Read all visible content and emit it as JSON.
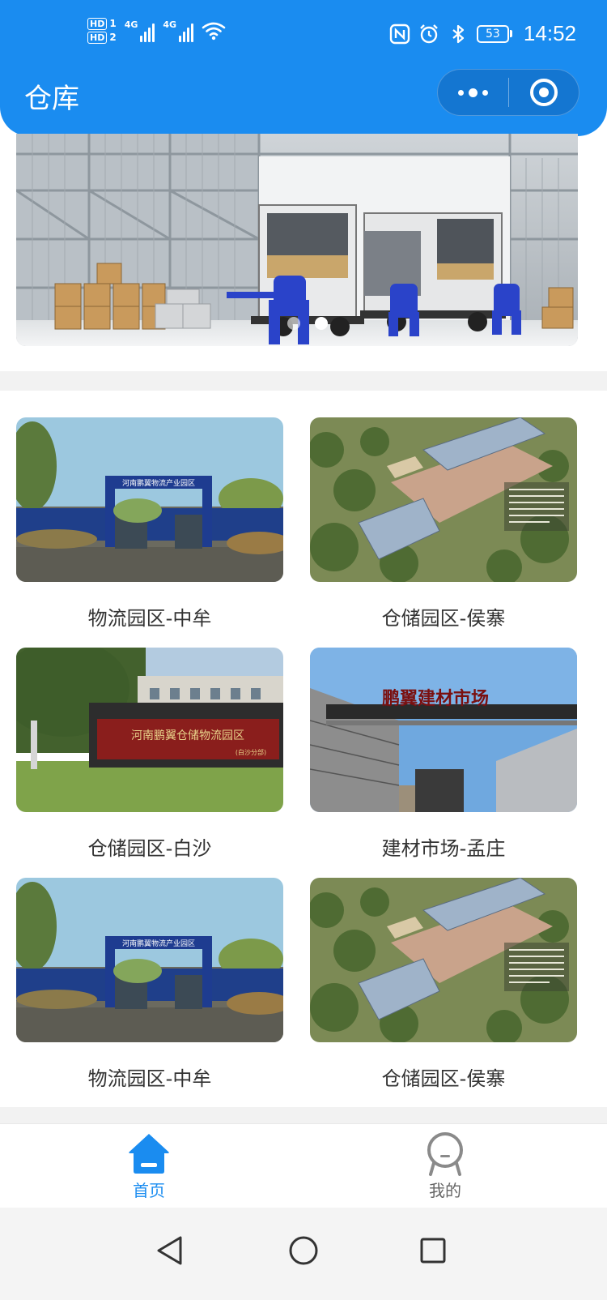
{
  "status_bar": {
    "hd1": "HD",
    "hd1_num": "1",
    "hd2": "HD",
    "hd2_num": "2",
    "signal1_label": "4G",
    "signal2_label": "4G",
    "battery_level": "53",
    "time": "14:52",
    "icons": [
      "nfc-icon",
      "alarm-icon",
      "bluetooth-icon",
      "wifi-icon"
    ]
  },
  "nav": {
    "title": "仓库",
    "more_icon": "more-dots-icon",
    "close_icon": "target-circle-icon"
  },
  "banner": {
    "active_index": 1,
    "dot_count": 2
  },
  "locations": [
    {
      "label": "物流园区-中牟"
    },
    {
      "label": "仓储园区-侯寨"
    },
    {
      "label": "仓储园区-白沙"
    },
    {
      "label": "建材市场-孟庄"
    },
    {
      "label": "物流园区-中牟"
    },
    {
      "label": "仓储园区-侯寨"
    }
  ],
  "photo_text": {
    "gate_sign": "河南鹏翼物流产业园区",
    "park_sign": "河南鹏翼仓储物流园区",
    "park_sign_sub": "(白沙分部)",
    "market_sign": "鹏翼建材市场"
  },
  "tabbar": {
    "home": "首页",
    "mine": "我的"
  },
  "colors": {
    "primary": "#1a8cf0",
    "tab_inactive": "#666666",
    "separator": "#f2f2f2"
  }
}
